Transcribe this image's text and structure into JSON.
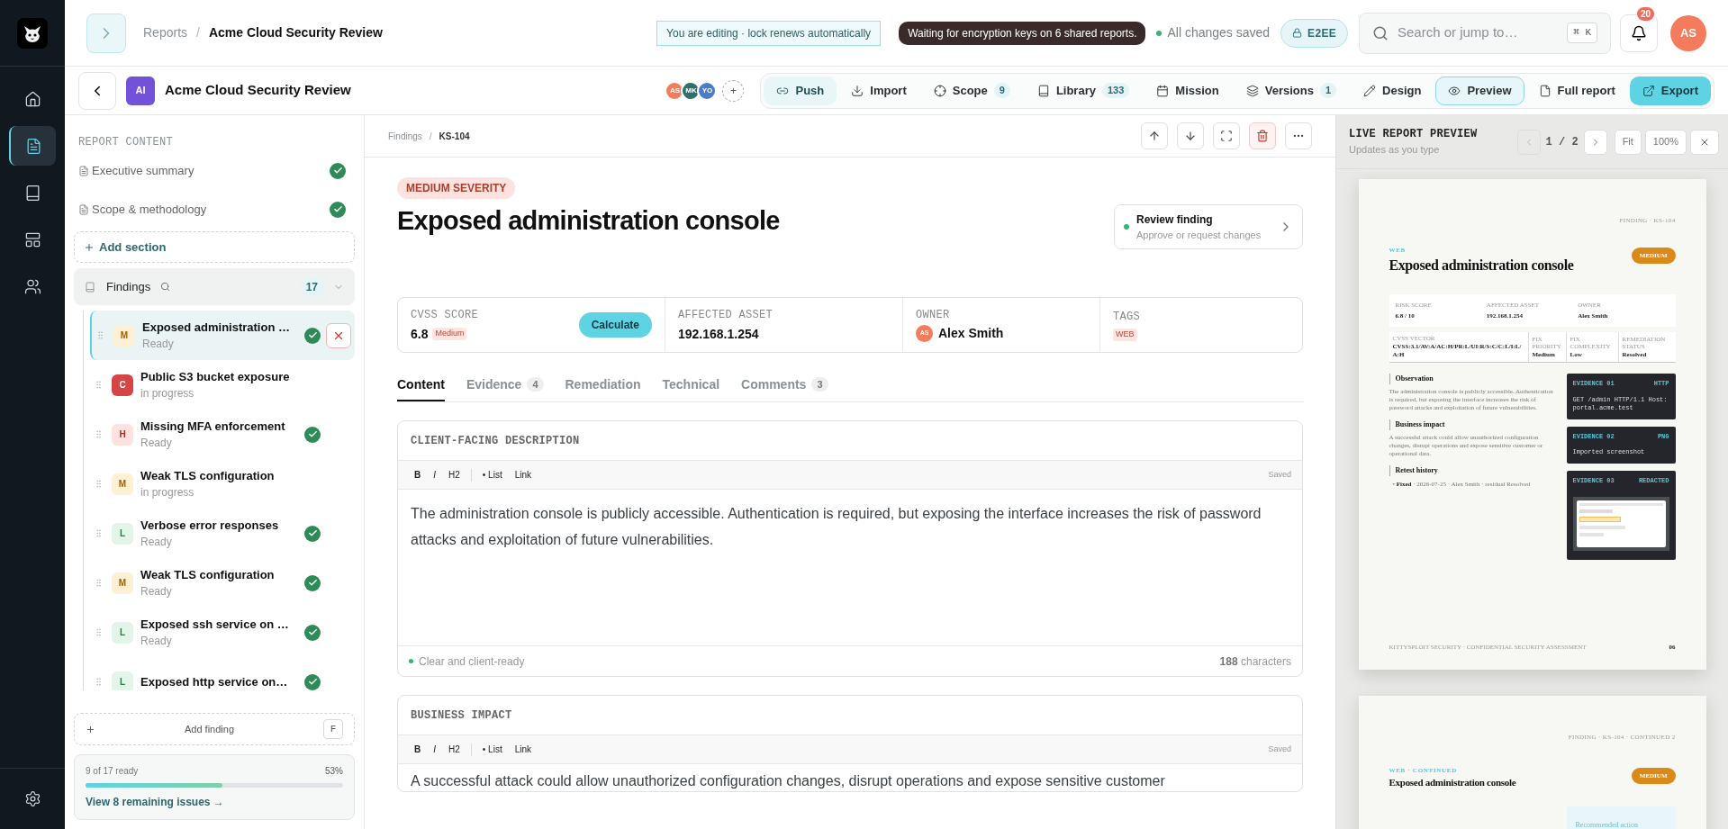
{
  "rail": {
    "items": [
      {
        "selected": false
      },
      {
        "selected": true
      },
      {
        "selected": false
      },
      {
        "selected": false
      },
      {
        "selected": false
      }
    ]
  },
  "topbar": {
    "breadcrumb_root": "Reports",
    "breadcrumb_separator": "/",
    "breadcrumb_current": "Acme Cloud Security Review",
    "editing_notice": "You are editing · lock renews automatically",
    "encryption_notice": "Waiting for encryption keys on 6 shared reports.",
    "save_status": "All changes saved",
    "e2ee_badge": "E2EE",
    "search": {
      "placeholder": "Search or jump to…",
      "shortcut": [
        "⌘",
        "K"
      ]
    },
    "notifications_count": "20",
    "user_initials": "AS"
  },
  "report_bar": {
    "avatar": "AI",
    "title": "Acme Cloud Security Review",
    "collaborators": [
      {
        "initials": "AS",
        "color": "#f47c5c"
      },
      {
        "initials": "MK",
        "color": "#2f6f6a"
      },
      {
        "initials": "YO",
        "color": "#4a7cc7"
      }
    ],
    "add_collaborator": "+",
    "actions": [
      {
        "label": "Push",
        "kind": "soft",
        "selected": false
      },
      {
        "label": "Import",
        "kind": "plain",
        "selected": false
      },
      {
        "label": "Scope",
        "count": "9",
        "kind": "plain",
        "selected": false
      },
      {
        "label": "Library",
        "count": "133",
        "kind": "plain",
        "selected": false
      },
      {
        "label": "Mission",
        "kind": "plain",
        "selected": false
      },
      {
        "label": "Versions",
        "count": "1",
        "kind": "plain",
        "selected": false
      },
      {
        "label": "Design",
        "kind": "plain",
        "selected": false
      },
      {
        "label": "Preview",
        "kind": "plain",
        "selected": true
      },
      {
        "label": "Full report",
        "kind": "plain",
        "selected": false
      },
      {
        "label": "Export",
        "kind": "primary",
        "selected": false
      }
    ]
  },
  "sidebar": {
    "heading": "REPORT CONTENT",
    "sections": [
      {
        "label": "Executive summary",
        "done": true
      },
      {
        "label": "Scope & methodology",
        "done": true
      }
    ],
    "add_section": "Add section",
    "findings_group": {
      "label": "Findings",
      "count": "17",
      "expanded": true,
      "items": [
        {
          "letter": "M",
          "kind": "medium",
          "title": "Exposed administration …",
          "status": "Ready",
          "done": true,
          "selected": true
        },
        {
          "letter": "C",
          "kind": "critical",
          "title": "Public S3 bucket exposure",
          "status": "in progress",
          "done": false,
          "selected": false
        },
        {
          "letter": "H",
          "kind": "high",
          "title": "Missing MFA enforcement",
          "status": "Ready",
          "done": true,
          "selected": false
        },
        {
          "letter": "M",
          "kind": "medium",
          "title": "Weak TLS configuration",
          "status": "in progress",
          "done": false,
          "selected": false
        },
        {
          "letter": "L",
          "kind": "low",
          "title": "Verbose error responses",
          "status": "Ready",
          "done": true,
          "selected": false
        },
        {
          "letter": "M",
          "kind": "medium",
          "title": "Weak TLS configuration",
          "status": "Ready",
          "done": true,
          "selected": false
        },
        {
          "letter": "L",
          "kind": "low",
          "title": "Exposed ssh service on …",
          "status": "Ready",
          "done": true,
          "selected": false
        },
        {
          "letter": "L",
          "kind": "low",
          "title": "Exposed http service on…",
          "done": true,
          "selected": false
        }
      ]
    },
    "add_finding": "Add finding",
    "add_finding_shortcut": "F",
    "progress": {
      "label": "9 of 17 ready",
      "percent": "53%",
      "level": 0.53,
      "link": "View 8 remaining issues →"
    }
  },
  "finding": {
    "breadcrumb": [
      "Findings",
      "KS-104"
    ],
    "breadcrumb_separator": "/",
    "severity_badge": "MEDIUM SEVERITY",
    "title": "Exposed administration console",
    "review": {
      "title": "Review finding",
      "subtitle": "Approve or request changes"
    },
    "cvss": {
      "label": "CVSS SCORE",
      "value": "6.8",
      "rating": "Medium",
      "button": "Calculate"
    },
    "asset": {
      "label": "AFFECTED ASSET",
      "value": "192.168.1.254"
    },
    "owner": {
      "label": "OWNER",
      "initials": "AS",
      "name": "Alex Smith"
    },
    "tags": {
      "label": "TAGS",
      "items": [
        "WEB"
      ]
    },
    "tabs": [
      {
        "label": "Content",
        "selected": true
      },
      {
        "label": "Evidence",
        "count": "4",
        "selected": false
      },
      {
        "label": "Remediation",
        "selected": false
      },
      {
        "label": "Technical",
        "selected": false
      },
      {
        "label": "Comments",
        "count": "3",
        "selected": false
      }
    ],
    "editors": [
      {
        "heading": "CLIENT-FACING DESCRIPTION",
        "toolbar": [
          {
            "label": "B",
            "kind": "bold"
          },
          {
            "label": "I",
            "kind": "italic"
          },
          {
            "label": "H2",
            "kind": "heading"
          },
          {
            "label": "• List",
            "kind": "list"
          },
          {
            "label": "Link",
            "kind": "link"
          }
        ],
        "saved": "Saved",
        "text": "The administration console is publicly accessible. Authentication is required, but exposing the interface increases the risk of password attacks and exploitation of future vulnerabilities.",
        "status": "Clear and client-ready",
        "count": "188",
        "count_suffix": "characters"
      },
      {
        "heading": "BUSINESS IMPACT",
        "toolbar": [
          {
            "label": "B",
            "kind": "bold"
          },
          {
            "label": "I",
            "kind": "italic"
          },
          {
            "label": "H2",
            "kind": "heading"
          },
          {
            "label": "• List",
            "kind": "list"
          },
          {
            "label": "Link",
            "kind": "link"
          }
        ],
        "saved": "Saved",
        "text": "A successful attack could allow unauthorized configuration changes, disrupt operations and expose sensitive customer"
      }
    ]
  },
  "preview": {
    "title": "LIVE REPORT PREVIEW",
    "subtitle": "Updates as you type",
    "page_indicator": "1 / 2",
    "fit": "Fit",
    "zoom": "100%",
    "pages": [
      {
        "header": "FINDING · KS-104",
        "category": "WEB",
        "title": "Exposed administration console",
        "severity": "MEDIUM",
        "meta_rows": [
          [
            {
              "label": "RISK SCORE",
              "value": "6.8 / 10"
            },
            {
              "label": "AFFECTED ASSET",
              "value": "192.168.1.254"
            },
            {
              "label": "OWNER",
              "value": "Alex Smith"
            }
          ],
          [
            {
              "label": "CVSS VECTOR",
              "value": "CVSS:3.1/AV:A/AC:H/PR:L/UI:R/S:C/C:L/I:L/A:H"
            },
            {
              "label": "FIX PRIORITY",
              "value": "Medium"
            },
            {
              "label": "FIX COMPLEXITY",
              "value": "Low"
            },
            {
              "label": "REMEDIATION STATUS",
              "value": "Resolved"
            }
          ]
        ],
        "sections": [
          {
            "heading": "Observation",
            "text": "The administration console is publicly accessible. Authentication is required, but exposing the interface increases the risk of password attacks and exploitation of future vulnerabilities."
          },
          {
            "heading": "Business impact",
            "text": "A successful attack could allow unauthorized configuration changes, disrupt operations and expose sensitive customer or operational data."
          },
          {
            "heading": "Retest history",
            "history": [
              {
                "marker": "•",
                "status": "Fixed",
                "detail": " · 2026-07-25 · Alex Smith · residual Resolved"
              }
            ]
          }
        ],
        "evidence": [
          {
            "label": "EVIDENCE 01",
            "type": "HTTP",
            "kind": "code",
            "body": "GET /admin HTTP/1.1 Host: portal.acme.test"
          },
          {
            "label": "EVIDENCE 02",
            "type": "PNG",
            "kind": "code",
            "body": "Imported screenshot"
          },
          {
            "label": "EVIDENCE 03",
            "type": "REDACTED",
            "kind": "image"
          }
        ],
        "footer": "KITTYSPLOIT SECURITY · CONFIDENTIAL SECURITY ASSESSMENT",
        "page_number": "06"
      },
      {
        "header": "FINDING · KS-104 · CONTINUED 2",
        "category": "WEB · CONTINUED",
        "title": "Exposed administration console",
        "severity": "MEDIUM",
        "callout": "Recommended action"
      }
    ]
  }
}
